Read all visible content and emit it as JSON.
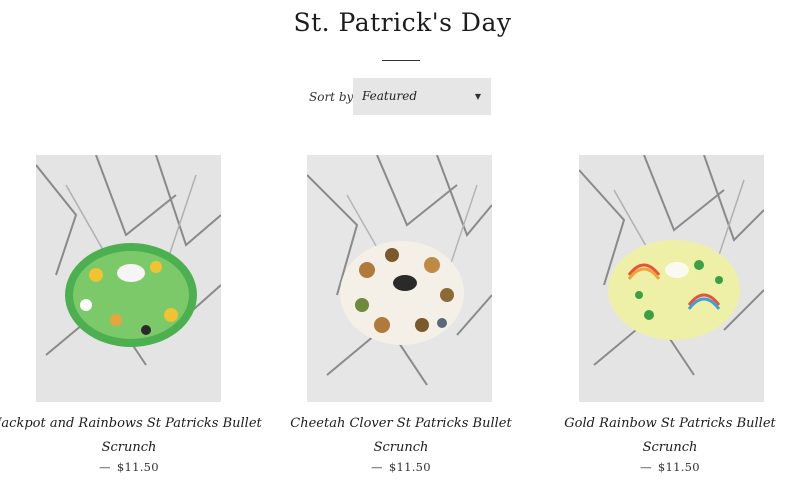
{
  "page": {
    "title": "St. Patrick's Day"
  },
  "sort": {
    "label": "Sort by",
    "selected": "Featured"
  },
  "products": [
    {
      "name_line1": "Jackpot and Rainbows St Patricks Bullet",
      "name_line2": "Scrunch",
      "price": "$11.50",
      "price_prefix": "—"
    },
    {
      "name_line1": "Cheetah Clover St Patricks Bullet",
      "name_line2": "Scrunch",
      "price": "$11.50",
      "price_prefix": "—"
    },
    {
      "name_line1": "Gold Rainbow St Patricks Bullet Scrunch",
      "name_line2": "",
      "price": "$11.50",
      "price_prefix": "—"
    }
  ],
  "colors": {
    "select_bg": "#e6e6e6",
    "text": "#1c1c1c"
  }
}
